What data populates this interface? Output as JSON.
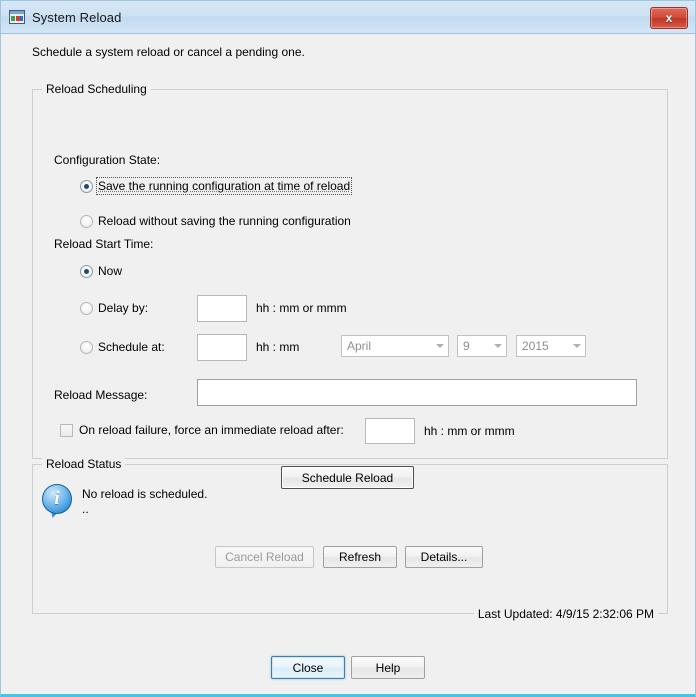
{
  "window": {
    "title": "System Reload",
    "icon": "system-reload-icon",
    "close_label": "x",
    "intro": "Schedule a system reload or cancel a pending one."
  },
  "scheduling": {
    "legend": "Reload Scheduling",
    "config_state_label": "Configuration State:",
    "config_options": [
      {
        "label": "Save the running configuration at time of reload",
        "selected": true,
        "focused": true
      },
      {
        "label": "Reload without saving the running configuration",
        "selected": false,
        "focused": false
      }
    ],
    "start_time_label": "Reload Start Time:",
    "start_options": [
      {
        "label": "Now",
        "selected": true
      },
      {
        "label": "Delay by:",
        "selected": false
      },
      {
        "label": "Schedule at:",
        "selected": false
      }
    ],
    "delay_value": "",
    "delay_hint": "hh : mm or mmm",
    "schedule_value": "",
    "schedule_hint": "hh : mm",
    "month_value": "April",
    "day_value": "9",
    "year_value": "2015",
    "message_label": "Reload Message:",
    "message_value": "",
    "force_checkbox_label": "On reload failure, force an immediate reload after:",
    "force_checked": false,
    "force_value": "",
    "force_hint": "hh : mm or mmm",
    "schedule_button": "Schedule Reload"
  },
  "status": {
    "legend": "Reload Status",
    "icon": "info-icon",
    "icon_glyph": "i",
    "message": "No reload is scheduled.\n..",
    "cancel_button": "Cancel Reload",
    "refresh_button": "Refresh",
    "details_button": "Details...",
    "last_updated": "Last Updated: 4/9/15 2:32:06 PM"
  },
  "footer": {
    "close_button": "Close",
    "help_button": "Help"
  }
}
